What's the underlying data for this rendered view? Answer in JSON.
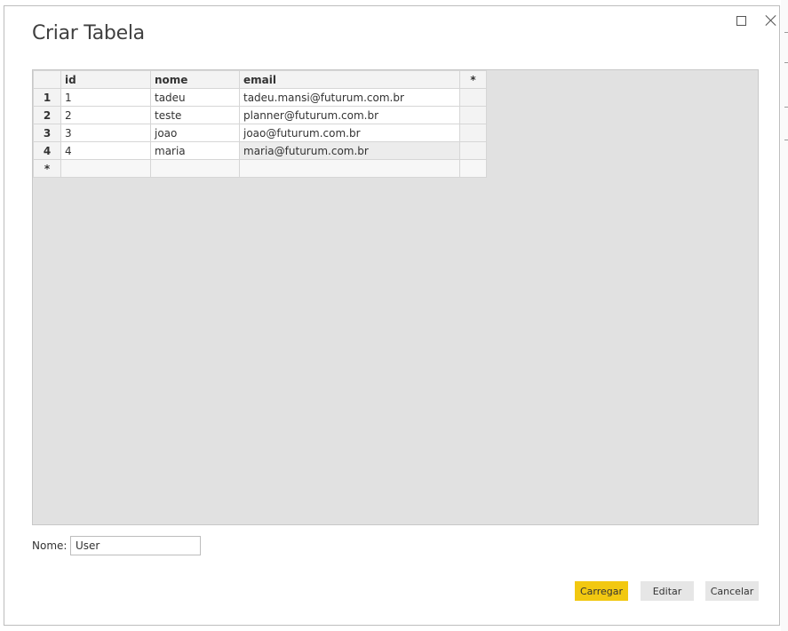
{
  "dialog": {
    "title": "Criar Tabela"
  },
  "table": {
    "headers": [
      "id",
      "nome",
      "email"
    ],
    "add_column_symbol": "*",
    "rows": [
      {
        "row_number": "1",
        "id": "1",
        "nome": "tadeu",
        "email": "tadeu.mansi@futurum.com.br"
      },
      {
        "row_number": "2",
        "id": "2",
        "nome": "teste",
        "email": "planner@futurum.com.br"
      },
      {
        "row_number": "3",
        "id": "3",
        "nome": "joao",
        "email": "joao@futurum.com.br"
      },
      {
        "row_number": "4",
        "id": "4",
        "nome": "maria",
        "email": "maria@futurum.com.br"
      }
    ],
    "new_row_symbol": "*"
  },
  "name_field": {
    "label": "Nome:",
    "value": "User"
  },
  "buttons": {
    "load": "Carregar",
    "edit": "Editar",
    "cancel": "Cancelar"
  },
  "colors": {
    "primary_button": "#f2c811",
    "grid_background": "#e1e1e1"
  }
}
